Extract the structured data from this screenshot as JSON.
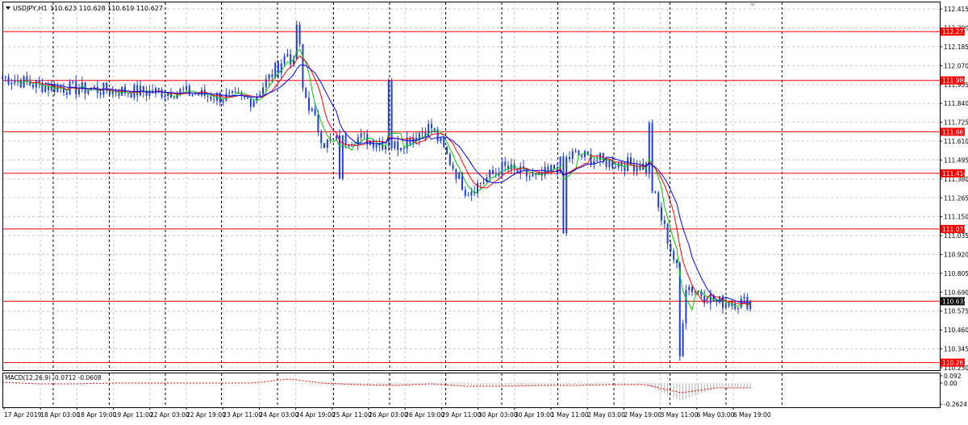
{
  "header": {
    "symbol_label": "USDJPY,H1",
    "ohlc_label": "110.623 110.628 110.619 110.627"
  },
  "macd_panel": {
    "label": "MACD(12,26,9) -0.0712 -0.0608"
  },
  "colors": {
    "candles": "#1f3fd9",
    "level_lines": "#ff0000",
    "ma_fast": "#00cc00",
    "ma_mid": "#ff0000",
    "ma_slow": "#0000ff",
    "macd_histogram": "#b0b0b0",
    "macd_signal": "#ff0000",
    "grid": "#c8c8c8",
    "price_tag_bg": "#ff0000",
    "price_tag_text": "#ffffff"
  },
  "chart_data": [
    {
      "type": "candlestick",
      "symbol": "USDJPY",
      "timeframe": "H1",
      "x_ticks": [
        "17 Apr 2019",
        "18 Apr 03:00",
        "18 Apr 19:00",
        "19 Apr 11:00",
        "22 Apr 03:00",
        "22 Apr 19:00",
        "23 Apr 11:00",
        "24 Apr 03:00",
        "24 Apr 19:00",
        "25 Apr 11:00",
        "26 Apr 03:00",
        "26 Apr 19:00",
        "29 Apr 11:00",
        "30 Apr 03:00",
        "30 Apr 19:00",
        "1 May 11:00",
        "2 May 03:00",
        "2 May 19:00",
        "3 May 11:00",
        "6 May 03:00",
        "6 May 19:00"
      ],
      "y_ticks": [
        "112.415",
        "112.300",
        "112.185",
        "112.070",
        "111.955",
        "111.840",
        "111.725",
        "111.610",
        "111.495",
        "111.380",
        "111.265",
        "111.150",
        "111.035",
        "110.920",
        "110.805",
        "110.690",
        "110.575",
        "110.460",
        "110.345",
        "110.230"
      ],
      "ylim": [
        110.215,
        112.455
      ],
      "grid": true,
      "horizontal_levels": [
        "112.277",
        "111.980",
        "111.667",
        "111.414",
        "111.075",
        "110.635",
        "110.261"
      ],
      "current_price": "110.635",
      "price_series": [
        {
          "x": "17 Apr 2019",
          "close": 112.0
        },
        {
          "x": "18 Apr 03:00",
          "close": 111.95
        },
        {
          "x": "18 Apr 19:00",
          "close": 111.93
        },
        {
          "x": "19 Apr 11:00",
          "close": 111.92
        },
        {
          "x": "22 Apr 03:00",
          "close": 111.91
        },
        {
          "x": "22 Apr 19:00",
          "close": 111.91
        },
        {
          "x": "23 Apr 11:00",
          "close": 111.88
        },
        {
          "x": "24 Apr 03:00",
          "close": 111.86
        },
        {
          "x": "24 Apr 19:00",
          "close": 112.15
        },
        {
          "x": "25 Apr 11:00",
          "close": 111.6
        },
        {
          "x": "26 Apr 03:00",
          "close": 111.63
        },
        {
          "x": "26 Apr 19:00",
          "close": 111.58
        },
        {
          "x": "29 Apr 11:00",
          "close": 111.7
        },
        {
          "x": "30 Apr 03:00",
          "close": 111.3
        },
        {
          "x": "30 Apr 19:00",
          "close": 111.45
        },
        {
          "x": "1 May 11:00",
          "close": 111.38
        },
        {
          "x": "2 May 03:00",
          "close": 111.53
        },
        {
          "x": "2 May 19:00",
          "close": 111.48
        },
        {
          "x": "3 May 11:00",
          "close": 111.46
        },
        {
          "x": "6 May 03:00",
          "close": 110.75
        },
        {
          "x": "6 May 19:00",
          "close": 110.63
        }
      ]
    },
    {
      "type": "line",
      "name": "MACD(12,26,9)",
      "values_printed": [
        "-0.0712",
        "-0.0608"
      ],
      "y_ticks": [
        "0.092",
        "0.00",
        "-0.2624"
      ],
      "ylim": [
        -0.3,
        0.12
      ],
      "histogram": [
        0.0,
        0.0,
        0.0,
        0.0,
        0.0,
        0.0,
        0.0,
        0.0,
        0.0,
        -0.02,
        -0.03,
        -0.03,
        -0.02,
        -0.03,
        -0.04,
        -0.03,
        -0.02,
        -0.02,
        -0.02,
        -0.22,
        -0.06
      ],
      "signal": [
        0.01,
        -0.01,
        -0.01,
        0.0,
        0.0,
        0.0,
        0.0,
        0.0,
        0.05,
        0.0,
        -0.02,
        -0.03,
        -0.01,
        -0.04,
        -0.04,
        -0.03,
        -0.03,
        -0.02,
        -0.02,
        -0.12,
        -0.06
      ]
    }
  ]
}
